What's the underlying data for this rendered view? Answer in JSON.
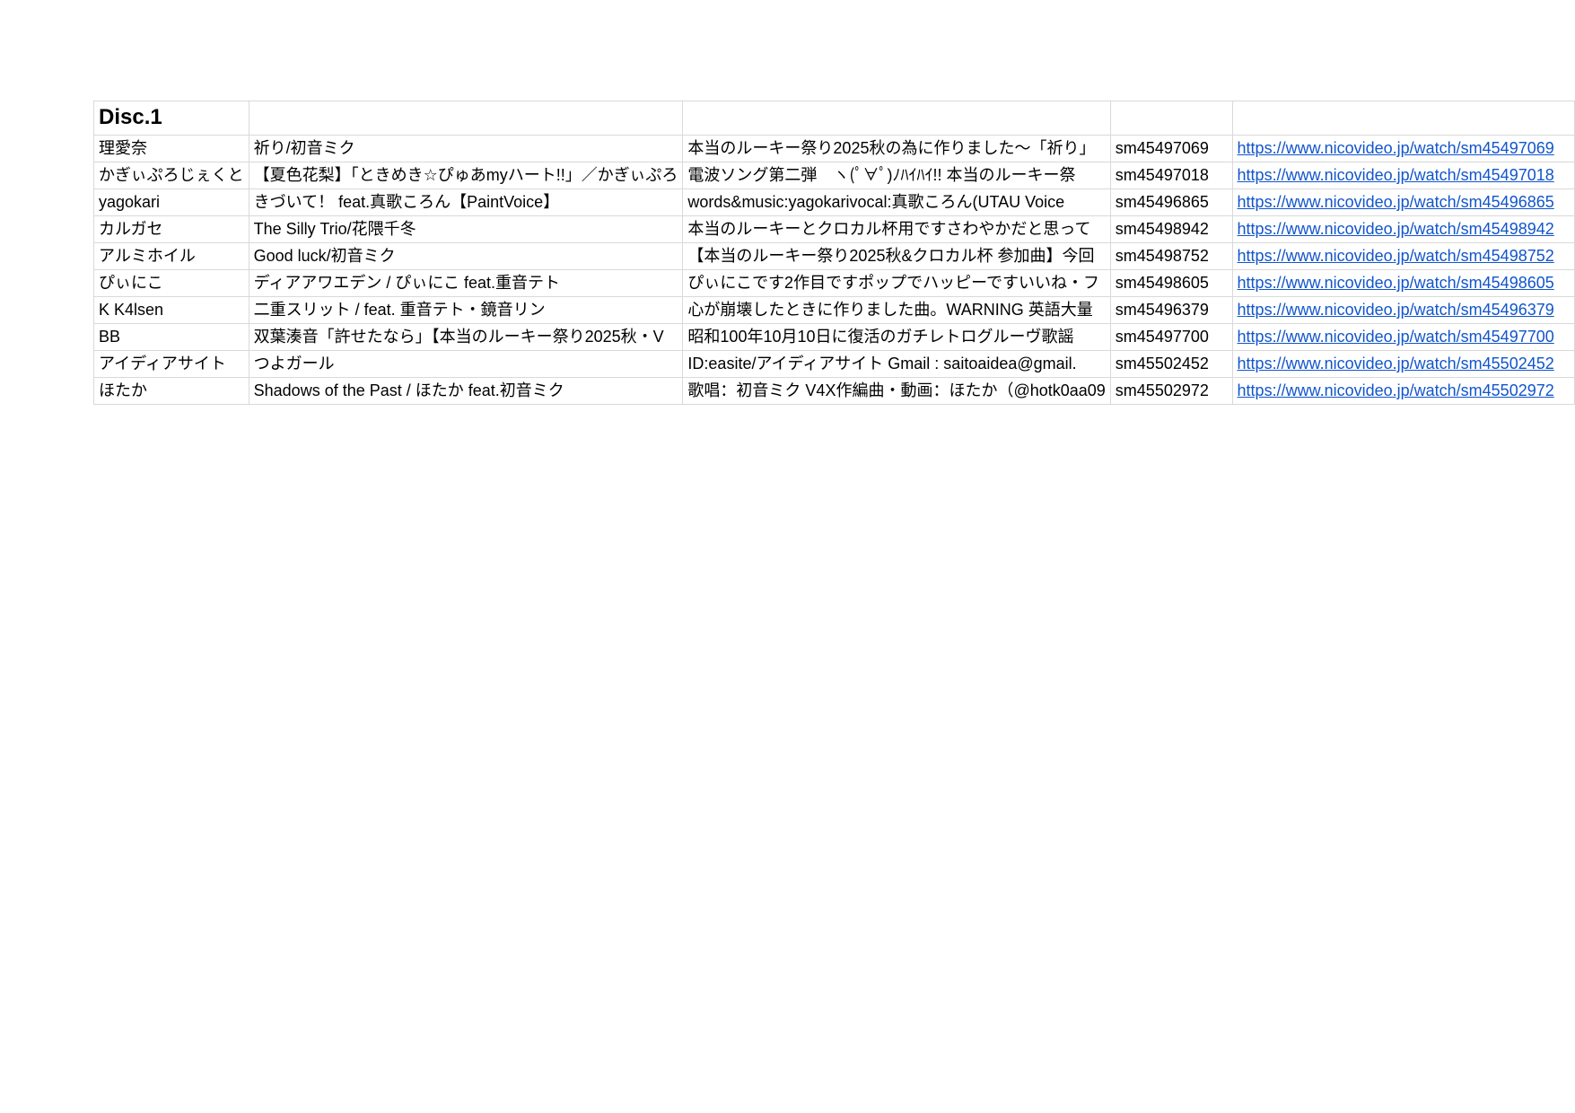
{
  "disc_title": "Disc.1",
  "rows": [
    {
      "artist": "理愛奈",
      "title": "祈り/初音ミク",
      "description": "本当のルーキー祭り2025秋の為に作りました〜「祈り」",
      "id": "sm45497069",
      "url": "https://www.nicovideo.jp/watch/sm45497069"
    },
    {
      "artist": "かぎぃぷろじぇくと",
      "title": "【夏色花梨】「ときめき☆ぴゅあmyハート!!」／かぎぃぷろ",
      "description": "電波ソング第二弾　ヽ(ﾟ∀ﾟ)ﾉﾊｲﾊｲ!! 本当のルーキー祭",
      "id": "sm45497018",
      "url": "https://www.nicovideo.jp/watch/sm45497018"
    },
    {
      "artist": "yagokari",
      "title": "きづいて！ feat.真歌ころん【PaintVoice】",
      "description": "words&music:yagokarivocal:真歌ころん(UTAU Voice",
      "id": "sm45496865",
      "url": "https://www.nicovideo.jp/watch/sm45496865"
    },
    {
      "artist": "カルガセ",
      "title": "The Silly Trio/花隈千冬",
      "description": "本当のルーキーとクロカル杯用ですさわやかだと思って",
      "id": "sm45498942",
      "url": "https://www.nicovideo.jp/watch/sm45498942"
    },
    {
      "artist": "アルミホイル",
      "title": "Good luck/初音ミク",
      "description": "【本当のルーキー祭り2025秋&クロカル杯 参加曲】今回",
      "id": "sm45498752",
      "url": "https://www.nicovideo.jp/watch/sm45498752"
    },
    {
      "artist": "ぴぃにこ",
      "title": "ディアアワエデン / ぴぃにこ feat.重音テト",
      "description": "ぴぃにこです2作目ですポップでハッピーですいいね・フ",
      "id": "sm45498605",
      "url": "https://www.nicovideo.jp/watch/sm45498605"
    },
    {
      "artist": "K K4lsen",
      "title": "二重スリット / feat. 重音テト・鏡音リン",
      "description": "心が崩壊したときに作りました曲。WARNING 英語大量",
      "id": "sm45496379",
      "url": "https://www.nicovideo.jp/watch/sm45496379"
    },
    {
      "artist": "BB",
      "title": "双葉湊音「許せたなら」【本当のルーキー祭り2025秋・V",
      "description": "昭和100年10月10日に復活のガチレトログルーヴ歌謡",
      "id": "sm45497700",
      "url": "https://www.nicovideo.jp/watch/sm45497700"
    },
    {
      "artist": "アイディアサイト",
      "title": "つよガール",
      "description": "ID:easite/アイディアサイト Gmail : saitoaidea@gmail.",
      "id": "sm45502452",
      "url": "https://www.nicovideo.jp/watch/sm45502452"
    },
    {
      "artist": "ほたか",
      "title": "Shadows of the Past / ほたか feat.初音ミク",
      "description": "歌唱：初音ミク V4X作編曲・動画：ほたか（@hotk0aa09",
      "id": "sm45502972",
      "url": "https://www.nicovideo.jp/watch/sm45502972"
    }
  ],
  "colors": {
    "grid": "#d9d9d9",
    "link": "#1155cc",
    "text": "#000000"
  }
}
